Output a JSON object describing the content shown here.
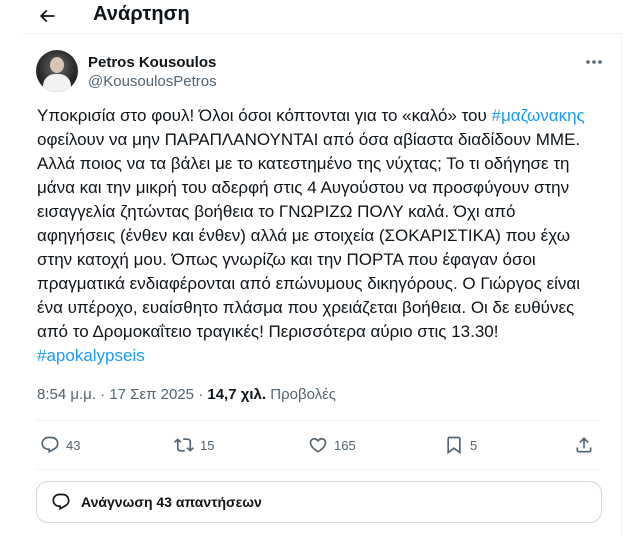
{
  "header": {
    "title": "Ανάρτηση"
  },
  "author": {
    "name": "Petros Kousoulos",
    "handle": "@KousoulosPetros"
  },
  "tweet": {
    "lines": [
      {
        "before": "Υποκρισία στο φουλ! Όλοι όσοι κόπτονται για το «καλό» του ",
        "hashtag": "#μαζωνακης",
        "after": ""
      },
      {
        "before": "οφείλουν να μην ΠΑΡΑΠΛΑΝΟΥΝΤΑΙ από όσα αβίαστα διαδίδουν ΜΜΕ.",
        "hashtag": "",
        "after": ""
      },
      {
        "before": "Αλλά ποιος να τα βάλει με το κατεστημένο της νύχτας; Το τι οδήγησε τη",
        "hashtag": "",
        "after": ""
      },
      {
        "before": "μάνα και την μικρή του αδερφή στις 4 Αυγούστου να προσφύγουν στην",
        "hashtag": "",
        "after": ""
      },
      {
        "before": "εισαγγελία ζητώντας βοήθεια το ΓΝΩΡΙΖΩ ΠΟΛΥ καλά. Όχι από",
        "hashtag": "",
        "after": ""
      },
      {
        "before": "αφηγήσεις (ένθεν και ένθεν) αλλά με στοιχεία (ΣΟΚΑΡΙΣΤΙΚΑ) που έχω",
        "hashtag": "",
        "after": ""
      },
      {
        "before": "στην κατοχή μου. Όπως γνωρίζω και την ΠΟΡΤΑ που έφαγαν όσοι",
        "hashtag": "",
        "after": ""
      },
      {
        "before": "πραγματικά ενδιαφέρονται από επώνυμους δικηγόρους. Ο Γιώργος είναι",
        "hashtag": "",
        "after": ""
      },
      {
        "before": "ένα υπέροχο, ευαίσθητο πλάσμα που χρειάζεται βοήθεια. Οι δε ευθύνες",
        "hashtag": "",
        "after": ""
      },
      {
        "before": "από το Δρομοκαΐτειο τραγικές! Περισσότερα αύριο στις 13.30!",
        "hashtag": "",
        "after": ""
      },
      {
        "before": "",
        "hashtag": "#apokalypseis",
        "after": ""
      }
    ]
  },
  "meta": {
    "time": "8:54 μ.μ.",
    "separator": " · ",
    "date": "17 Σεπ 2025",
    "views_count": "14,7 χιλ.",
    "views_label": " Προβολές"
  },
  "actions": {
    "replies": "43",
    "reposts": "15",
    "likes": "165",
    "bookmarks": "5"
  },
  "replies_button": {
    "label": "Ανάγνωση 43 απαντήσεων"
  },
  "colors": {
    "link": "#1d9bf0",
    "secondary_text": "#536471",
    "primary_text": "#0f1419"
  }
}
